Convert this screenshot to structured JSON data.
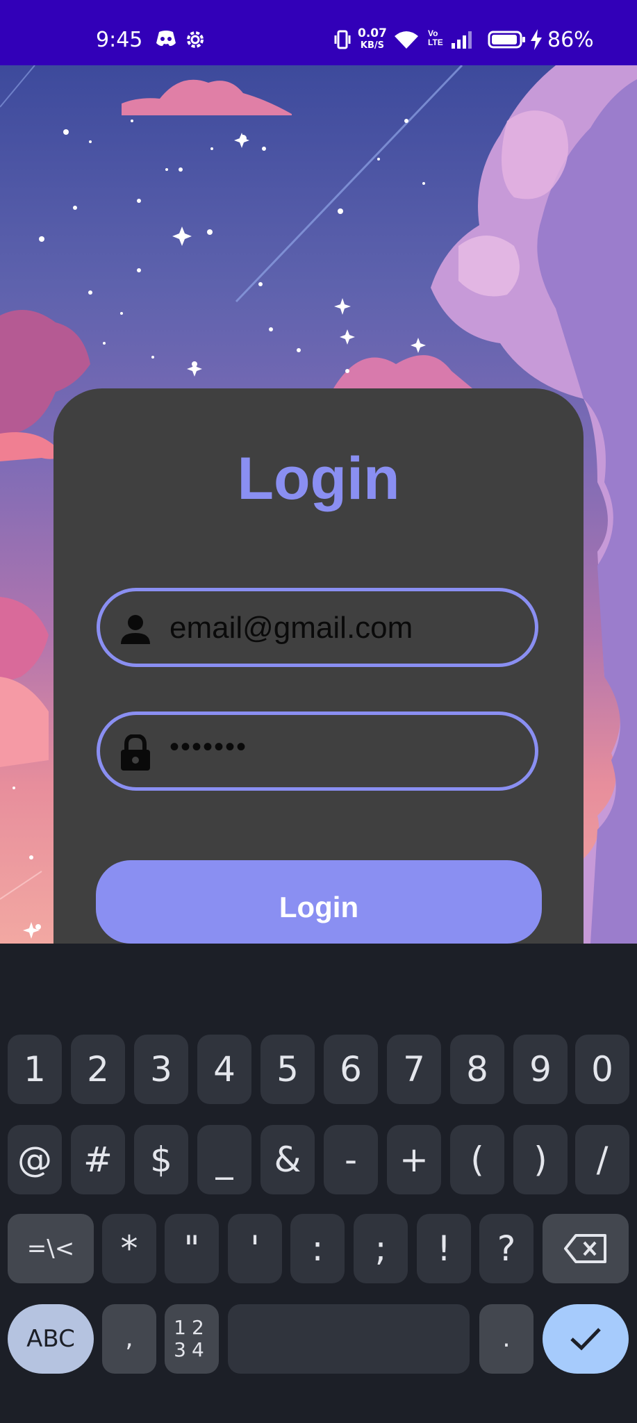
{
  "status_bar": {
    "time": "9:45",
    "speed_value": "0.07",
    "speed_unit": "KB/S",
    "battery": "86%",
    "icons": [
      "discord-icon",
      "settings-gear-icon",
      "vibrate-icon",
      "wifi-icon",
      "volte-icon",
      "signal-icon",
      "battery-icon",
      "charging-icon"
    ]
  },
  "login_card": {
    "title": "Login",
    "email_value": "email@gmail.com",
    "password_value": "•••••••",
    "button_label": "Login",
    "accent_color": "#8a8ff2",
    "card_color": "#404040"
  },
  "keyboard": {
    "row1": [
      "1",
      "2",
      "3",
      "4",
      "5",
      "6",
      "7",
      "8",
      "9",
      "0"
    ],
    "row2": [
      "@",
      "#",
      "$",
      "_",
      "&",
      "-",
      "+",
      "(",
      ")",
      "/"
    ],
    "row3": [
      "=\\<",
      "*",
      "\"",
      "'",
      ":",
      ";",
      "!",
      "?"
    ],
    "row4": {
      "abc": "ABC",
      "comma": ",",
      "nums_top": "12",
      "nums_bottom": "34",
      "period": "."
    }
  }
}
